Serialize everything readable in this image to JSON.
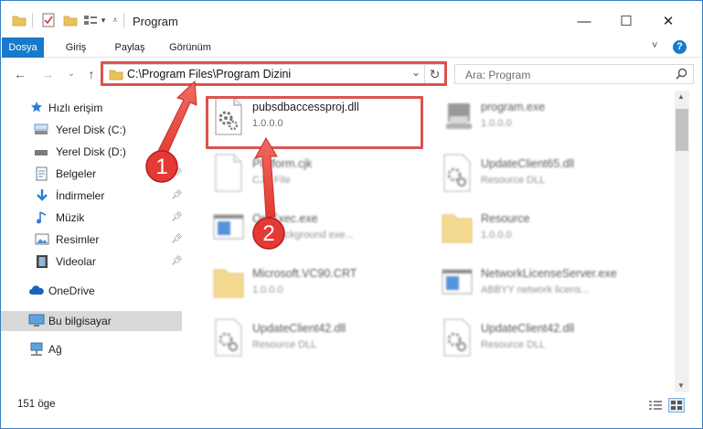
{
  "window": {
    "title": "Program",
    "controls": {
      "minimize": "—",
      "maximize": "☐",
      "close": "✕"
    }
  },
  "ribbon": {
    "tabs": [
      "Dosya",
      "Giriş",
      "Paylaş",
      "Görünüm"
    ],
    "help": "?",
    "expand": "˅"
  },
  "address": {
    "path": "C:\\Program Files\\Program Dizini",
    "dropdown": "⌄",
    "refresh": "↻"
  },
  "search": {
    "placeholder": "Ara: Program"
  },
  "nav": {
    "back": "←",
    "forward": "→",
    "recent": "⌄",
    "up": "↑"
  },
  "sidebar": {
    "items": [
      {
        "label": "Hızlı erişim",
        "icon": "star-icon"
      },
      {
        "label": "Yerel Disk (C:)",
        "icon": "drive-icon"
      },
      {
        "label": "Yerel Disk (D:)",
        "icon": "drive-icon"
      },
      {
        "label": "Belgeler",
        "icon": "documents-icon"
      },
      {
        "label": "İndirmeler",
        "icon": "download-icon"
      },
      {
        "label": "Müzik",
        "icon": "music-icon"
      },
      {
        "label": "Resimler",
        "icon": "pictures-icon"
      },
      {
        "label": "Videolar",
        "icon": "video-icon"
      },
      {
        "label": "OneDrive",
        "icon": "cloud-icon"
      },
      {
        "label": "Bu bilgisayar",
        "icon": "computer-icon"
      },
      {
        "label": "Ağ",
        "icon": "network-icon"
      }
    ]
  },
  "files": [
    {
      "name": "pubsdbaccessproj.dll",
      "sub": "1.0.0.0",
      "icon": "dll-gear-icon"
    },
    {
      "name": "program.exe",
      "sub": "1.0.0.0",
      "icon": "exe-icon"
    },
    {
      "name": "Platform.cjk",
      "sub": "CJK File",
      "icon": "blank-file-icon"
    },
    {
      "name": "UpdateClient65.dll",
      "sub": "Resource DLL",
      "icon": "dll-gear-icon"
    },
    {
      "name": "OptExec.exe",
      "sub": "Run background exe...",
      "icon": "window-icon"
    },
    {
      "name": "Resource",
      "sub": "1.0.0.0",
      "icon": "folder-icon"
    },
    {
      "name": "Microsoft.VC90.CRT",
      "sub": "1.0.0.0",
      "icon": "folder-icon"
    },
    {
      "name": "NetworkLicenseServer.exe",
      "sub": "ABBYY network licens...",
      "icon": "window-icon"
    },
    {
      "name": "UpdateClient42.dll",
      "sub": "Resource DLL",
      "icon": "dll-gear-icon"
    },
    {
      "name": "UpdateClient42.dll",
      "sub": "Resource DLL",
      "icon": "dll-gear-icon"
    }
  ],
  "status": {
    "count": "151 öge"
  },
  "annotations": {
    "step1": "1",
    "step2": "2"
  },
  "colors": {
    "accent": "#1979ca",
    "highlight": "#d9534f",
    "selected": "#d9d9d9"
  }
}
